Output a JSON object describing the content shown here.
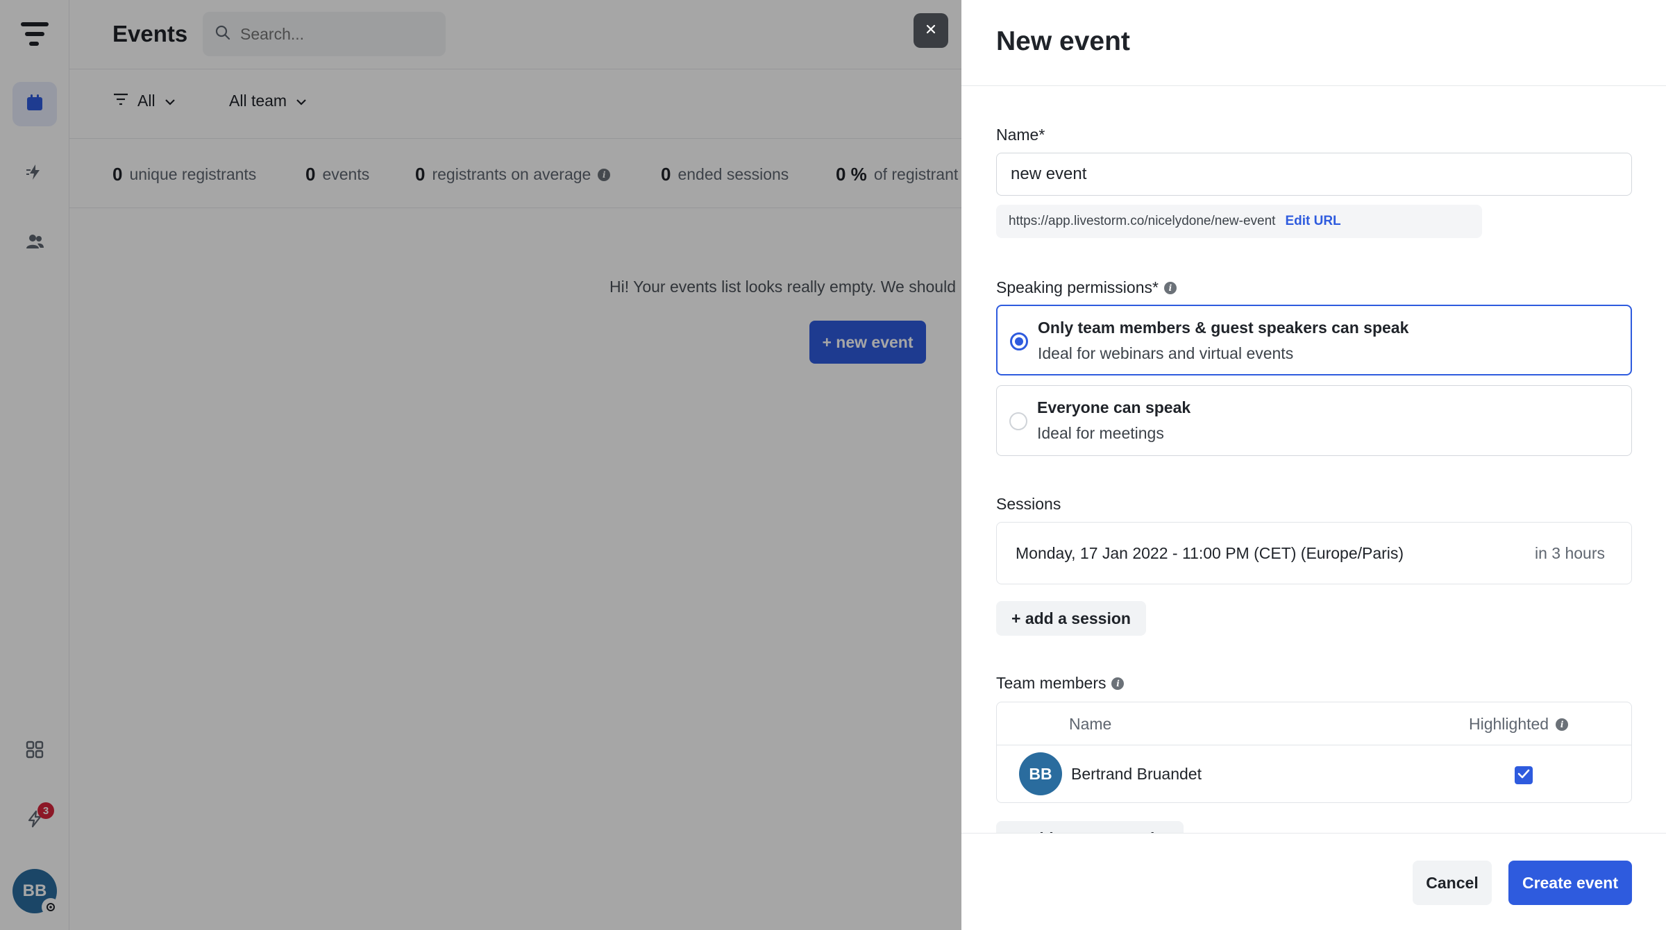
{
  "app": {
    "colors": {
      "accent": "#2e5bde",
      "avatar": "#2a6c9e",
      "badge": "#d7263d"
    }
  },
  "rail": {
    "items": [
      {
        "icon": "events-calendar-icon",
        "active": true
      },
      {
        "icon": "automation-icon",
        "active": false
      },
      {
        "icon": "people-icon",
        "active": false
      }
    ],
    "apps_icon": "apps-grid-icon",
    "notifications_badge": "3",
    "avatar_initials": "BB"
  },
  "events_page": {
    "title": "Events",
    "search_placeholder": "Search...",
    "filter_all": "All",
    "filter_team": "All team",
    "stats": [
      {
        "value": "0",
        "label": "unique registrants"
      },
      {
        "value": "0",
        "label": "events"
      },
      {
        "value": "0",
        "label": "registrants on average"
      },
      {
        "value": "0",
        "label": "ended sessions"
      },
      {
        "value": "0 %",
        "label": "of registrant"
      }
    ],
    "empty_message": "Hi! Your events list looks really empty. We should",
    "new_event_button": "+ new event"
  },
  "drawer": {
    "title": "New event",
    "name_label": "Name*",
    "name_value": "new event",
    "url": "https://app.livestorm.co/nicelydone/new-event",
    "edit_url": "Edit URL",
    "speaking_label": "Speaking permissions*",
    "speaking_options": [
      {
        "title": "Only team members & guest speakers can speak",
        "subtitle": "Ideal for webinars and virtual events",
        "selected": true
      },
      {
        "title": "Everyone can speak",
        "subtitle": "Ideal for meetings",
        "selected": false
      }
    ],
    "sessions_label": "Sessions",
    "session": {
      "datetime": "Monday, 17 Jan 2022 - 11:00 PM (CET) (Europe/Paris)",
      "relative": "in 3 hours"
    },
    "add_session": "+ add a session",
    "team_label": "Team members",
    "team_columns": {
      "name": "Name",
      "highlighted": "Highlighted"
    },
    "team_members": [
      {
        "initials": "BB",
        "name": "Bertrand Bruandet",
        "highlighted": true
      }
    ],
    "add_member": "+ add a team member",
    "cancel": "Cancel",
    "create": "Create event"
  }
}
